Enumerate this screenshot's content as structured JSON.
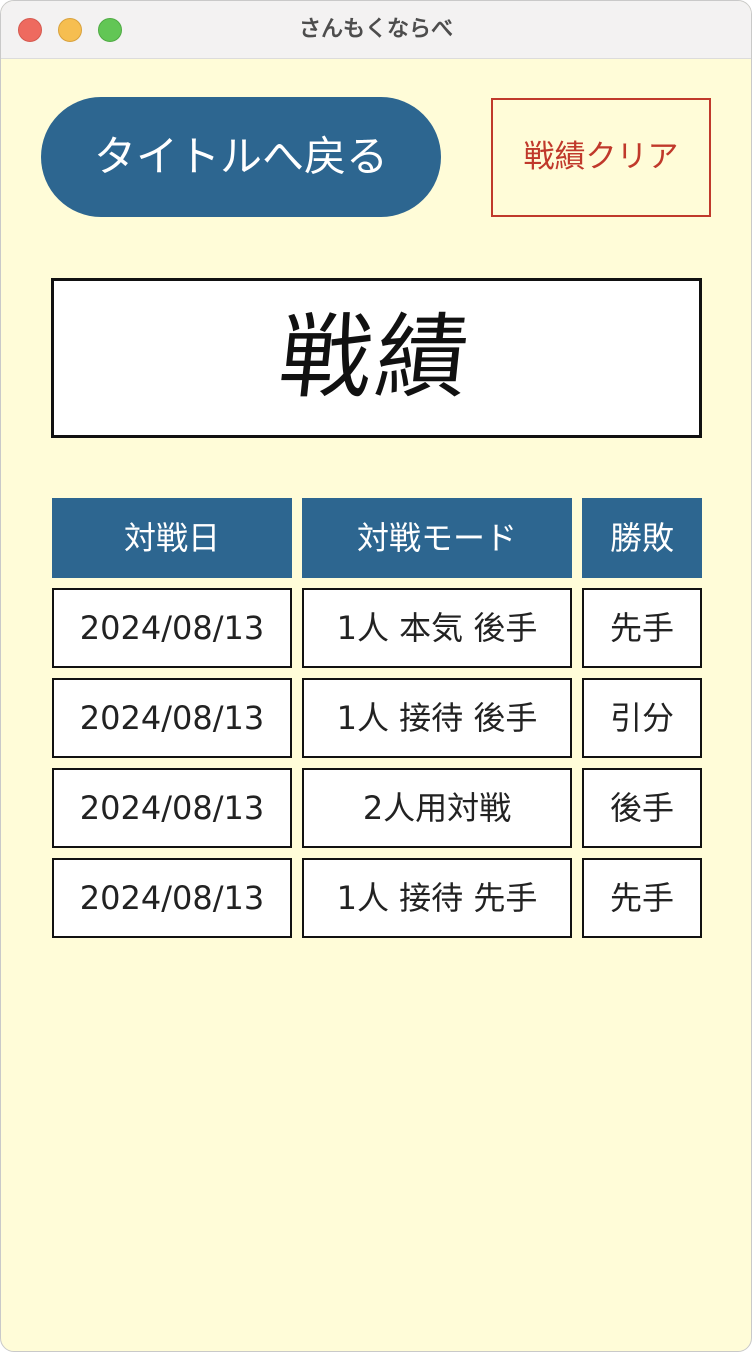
{
  "window": {
    "title": "さんもくならべ"
  },
  "toolbar": {
    "back_label": "タイトルへ戻る",
    "clear_label": "戦績クリア"
  },
  "heading": "戦績",
  "table": {
    "headers": [
      "対戦日",
      "対戦モード",
      "勝敗"
    ],
    "rows": [
      [
        "2024/08/13",
        "1人 本気 後手",
        "先手"
      ],
      [
        "2024/08/13",
        "1人 接待 後手",
        "引分"
      ],
      [
        "2024/08/13",
        "2人用対戦",
        "後手"
      ],
      [
        "2024/08/13",
        "1人 接待 先手",
        "先手"
      ]
    ]
  },
  "colors": {
    "background": "#fffcd8",
    "accent": "#2d6690",
    "danger": "#c0392b"
  }
}
